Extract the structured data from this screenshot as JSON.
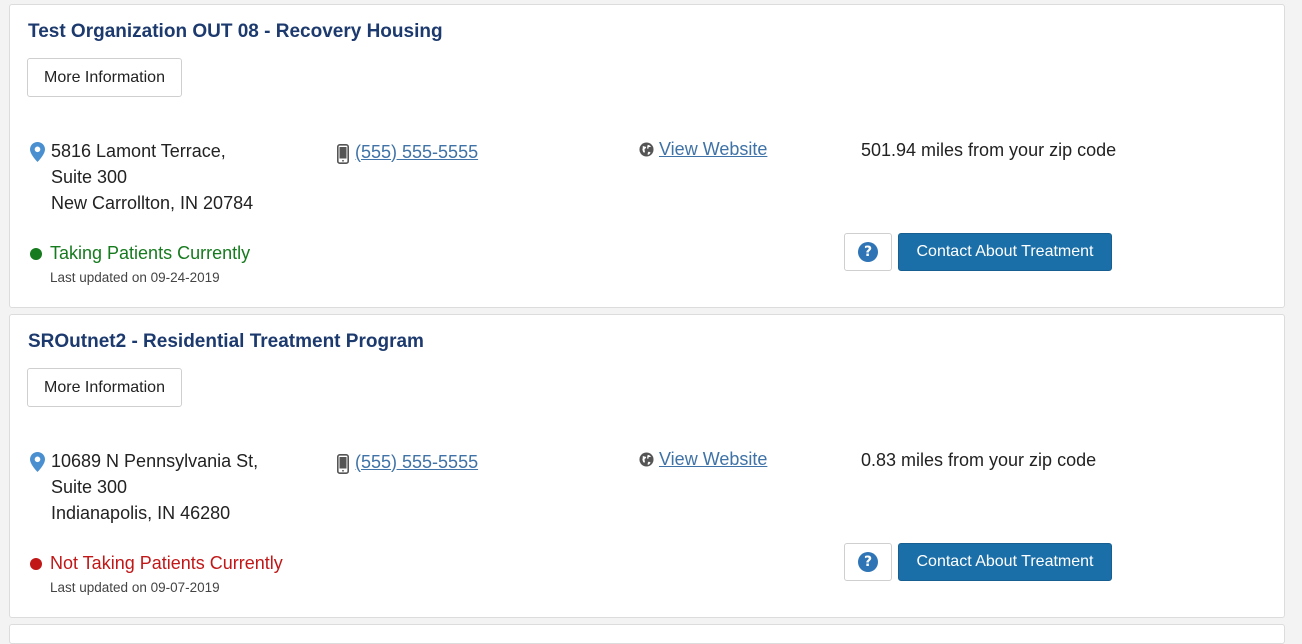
{
  "colors": {
    "title": "#1d3a6e",
    "link": "#3f72a7",
    "accepting": "#167a1e",
    "not_accepting": "#c11717",
    "primary_button": "#1b6fa8",
    "pin_icon": "#4a90d0"
  },
  "listings": [
    {
      "title": "Test Organization OUT 08 - Recovery Housing",
      "more_info_label": "More Information",
      "address": {
        "line1": "5816 Lamont Terrace,",
        "line2": "Suite 300",
        "line3": "New Carrollton, IN 20784"
      },
      "phone": "(555) 555-5555",
      "website_label": "View Website",
      "distance": "501.94 miles from your zip code",
      "status": "Taking Patients Currently",
      "accepting": true,
      "last_updated": "Last updated on 09-24-2019",
      "help_icon": "question-circle-icon",
      "contact_label": "Contact About Treatment"
    },
    {
      "title": "SROutnet2 - Residential Treatment Program",
      "more_info_label": "More Information",
      "address": {
        "line1": "10689 N Pennsylvania St,",
        "line2": "Suite 300",
        "line3": "Indianapolis, IN 46280"
      },
      "phone": "(555) 555-5555",
      "website_label": "View Website",
      "distance": "0.83 miles from your zip code",
      "status": "Not Taking Patients Currently",
      "accepting": false,
      "last_updated": "Last updated on 09-07-2019",
      "help_icon": "question-circle-icon",
      "contact_label": "Contact About Treatment"
    }
  ]
}
